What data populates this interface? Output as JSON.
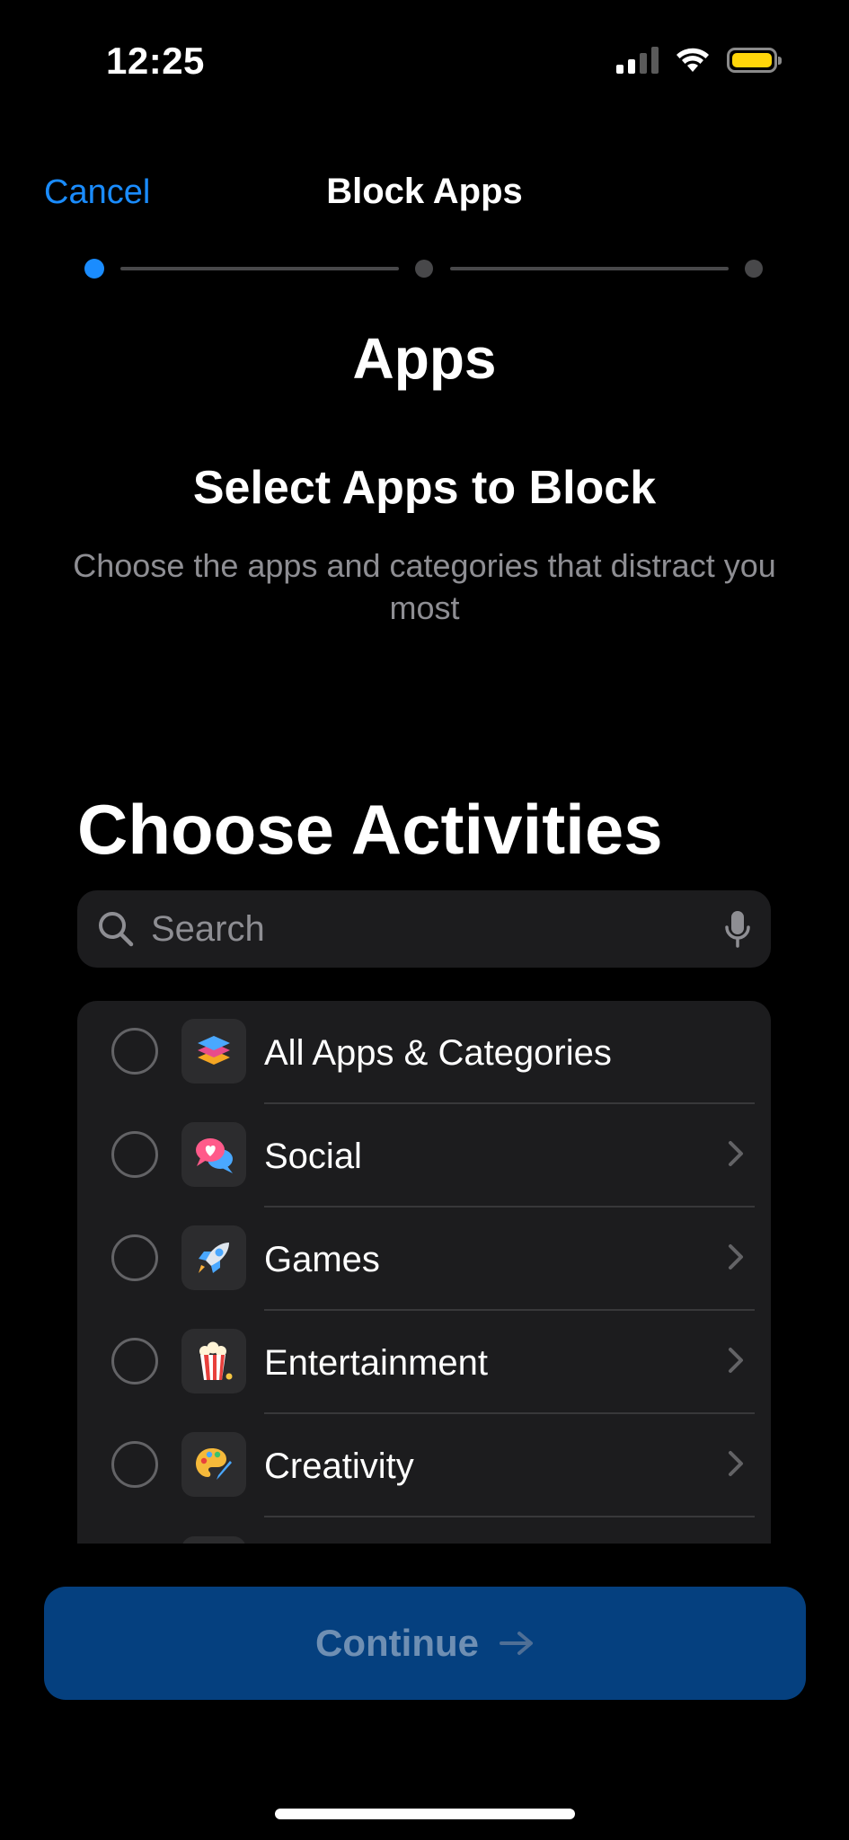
{
  "status_bar": {
    "time": "12:25",
    "battery_color": "#ffd60a"
  },
  "nav": {
    "cancel_label": "Cancel",
    "title": "Block Apps"
  },
  "stepper": {
    "total_steps": 3,
    "current_step": 1,
    "active_color": "#1a8cff"
  },
  "header": {
    "section_title": "Apps",
    "select_title": "Select Apps to Block",
    "subtitle": "Choose the apps and categories that distract you most"
  },
  "picker": {
    "title": "Choose Activities",
    "search": {
      "placeholder": "Search",
      "value": ""
    },
    "items": [
      {
        "label": "All Apps & Categories",
        "icon": "stack-icon",
        "has_chevron": false
      },
      {
        "label": "Social",
        "icon": "chat-bubbles-icon",
        "has_chevron": true
      },
      {
        "label": "Games",
        "icon": "rocket-icon",
        "has_chevron": true
      },
      {
        "label": "Entertainment",
        "icon": "popcorn-icon",
        "has_chevron": true
      },
      {
        "label": "Creativity",
        "icon": "palette-icon",
        "has_chevron": true
      }
    ]
  },
  "footer": {
    "continue_label": "Continue",
    "continue_bg": "#05407f"
  }
}
